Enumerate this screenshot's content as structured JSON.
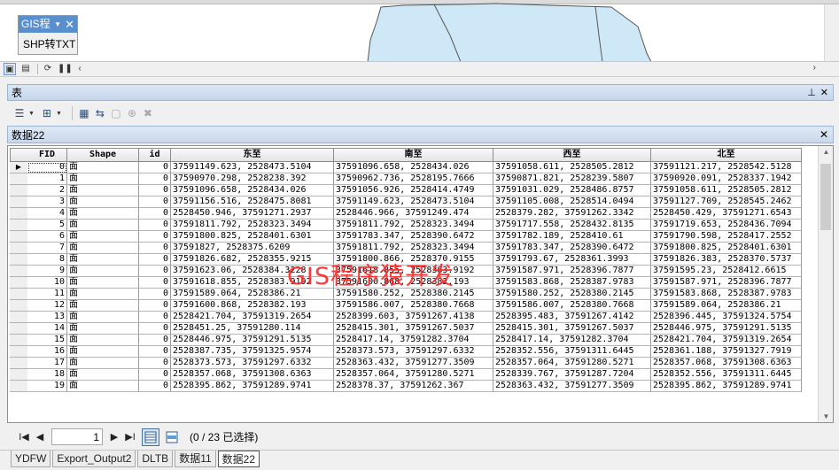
{
  "map_toolbar": {
    "title": "GIS程",
    "button_label": "SHP转TXT"
  },
  "table_pane": {
    "title": "表",
    "pin_glyph": "📌",
    "close_glyph": "✕"
  },
  "layer": {
    "name": "数据22"
  },
  "grid": {
    "columns": [
      "FID",
      "Shape",
      "id",
      "东至",
      "南至",
      "西至",
      "北至"
    ],
    "rows": [
      [
        "0",
        "面",
        "0",
        "37591149.623, 2528473.5104",
        "37591096.658, 2528434.026",
        "37591058.611, 2528505.2812",
        "37591121.217, 2528542.5128"
      ],
      [
        "1",
        "面",
        "0",
        "37590970.298, 2528238.392",
        "37590962.736, 2528195.7666",
        "37590871.821, 2528239.5807",
        "37590920.091, 2528337.1942"
      ],
      [
        "2",
        "面",
        "0",
        "37591096.658, 2528434.026",
        "37591056.926, 2528414.4749",
        "37591031.029, 2528486.8757",
        "37591058.611, 2528505.2812"
      ],
      [
        "3",
        "面",
        "0",
        "37591156.516, 2528475.8081",
        "37591149.623, 2528473.5104",
        "37591105.008, 2528514.0494",
        "37591127.709, 2528545.2462"
      ],
      [
        "4",
        "面",
        "0",
        "2528450.946, 37591271.2937",
        "2528446.966, 37591249.474",
        "2528379.282, 37591262.3342",
        "2528450.429, 37591271.6543"
      ],
      [
        "5",
        "面",
        "0",
        "37591811.792, 2528323.3494",
        "37591811.792, 2528323.3494",
        "37591717.558, 2528432.8135",
        "37591719.653, 2528436.7094"
      ],
      [
        "6",
        "面",
        "0",
        "37591800.825, 2528401.6301",
        "37591783.347, 2528390.6472",
        "37591782.189, 2528410.61",
        "37591790.598, 2528417.2552"
      ],
      [
        "7",
        "面",
        "0",
        "37591827, 2528375.6209",
        "37591811.792, 2528323.3494",
        "37591783.347, 2528390.6472",
        "37591800.825, 2528401.6301"
      ],
      [
        "8",
        "面",
        "0",
        "37591826.682, 2528355.9215",
        "37591800.866, 2528370.9155",
        "37591793.67, 2528361.3993",
        "37591826.383, 2528370.5737"
      ],
      [
        "9",
        "面",
        "0",
        "37591623.06, 2528384.3228",
        "37591618.855, 2528383.9192",
        "37591587.971, 2528396.7877",
        "37591595.23, 2528412.6615"
      ],
      [
        "10",
        "面",
        "0",
        "37591618.855, 2528383.9192",
        "37591600.868, 2528382.193",
        "37591583.868, 2528387.9783",
        "37591587.971, 2528396.7877"
      ],
      [
        "11",
        "面",
        "0",
        "37591589.064, 2528386.21",
        "37591580.252, 2528380.2145",
        "37591580.252, 2528380.2145",
        "37591583.868, 2528387.9783"
      ],
      [
        "12",
        "面",
        "0",
        "37591600.868, 2528382.193",
        "37591586.007, 2528380.7668",
        "37591586.007, 2528380.7668",
        "37591589.064, 2528386.21"
      ],
      [
        "13",
        "面",
        "0",
        "2528421.704, 37591319.2654",
        "2528399.603, 37591267.4138",
        "2528395.483, 37591267.4142",
        "2528396.445, 37591324.5754"
      ],
      [
        "14",
        "面",
        "0",
        "2528451.25, 37591280.114",
        "2528415.301, 37591267.5037",
        "2528415.301, 37591267.5037",
        "2528446.975, 37591291.5135"
      ],
      [
        "15",
        "面",
        "0",
        "2528446.975, 37591291.5135",
        "2528417.14, 37591282.3704",
        "2528417.14, 37591282.3704",
        "2528421.704, 37591319.2654"
      ],
      [
        "16",
        "面",
        "0",
        "2528387.735, 37591325.9574",
        "2528373.573, 37591297.6332",
        "2528352.556, 37591311.6445",
        "2528361.188, 37591327.7919"
      ],
      [
        "17",
        "面",
        "0",
        "2528373.573, 37591297.6332",
        "2528363.432, 37591277.3509",
        "2528357.064, 37591280.5271",
        "2528357.068, 37591308.6363"
      ],
      [
        "18",
        "面",
        "0",
        "2528357.068, 37591308.6363",
        "2528357.064, 37591280.5271",
        "2528339.767, 37591287.7204",
        "2528352.556, 37591311.6445"
      ],
      [
        "19",
        "面",
        "0",
        "2528395.862, 37591289.9741",
        "2528378.37, 37591262.367",
        "2528363.432, 37591277.3509",
        "2528395.862, 37591289.9741"
      ]
    ]
  },
  "watermark": "GIS程序猿开发",
  "nav": {
    "first": "I◀",
    "prev": "◀",
    "record": "1",
    "next": "▶",
    "last": "▶I",
    "selection_status": "(0 / 23 已选择)"
  },
  "bottom_tabs": [
    "YDFW",
    "Export_Output2",
    "DLTB",
    "数据11",
    "数据22"
  ],
  "colors": {
    "map_polygon": "#cfe8f7",
    "pane_title": "#c5d6ec",
    "watermark": "#ff2a2a"
  }
}
